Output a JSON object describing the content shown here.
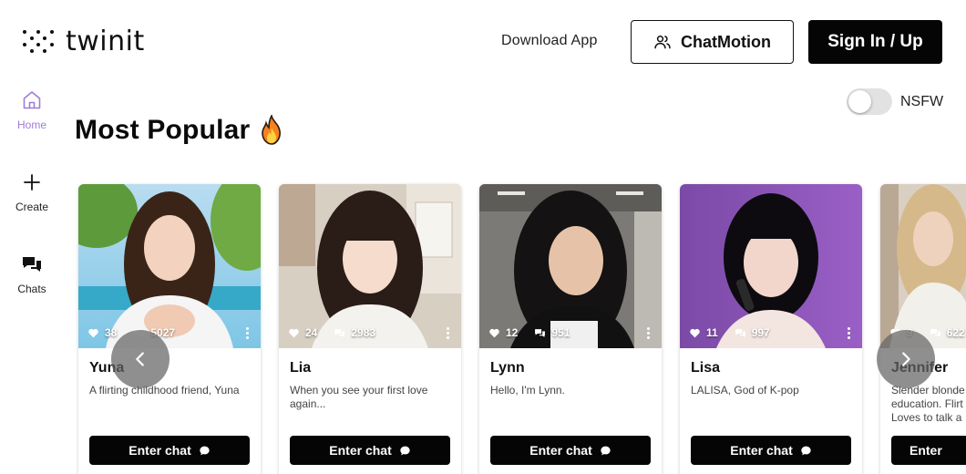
{
  "header": {
    "logo_text": "twinit",
    "download_label": "Download App",
    "chatmotion_label": "ChatMotion",
    "signin_label": "Sign In / Up"
  },
  "sidebar": {
    "items": [
      {
        "label": "Home",
        "icon": "home-icon",
        "active": true
      },
      {
        "label": "Create",
        "icon": "plus-icon",
        "active": false
      },
      {
        "label": "Chats",
        "icon": "chat-bubbles-icon",
        "active": false
      }
    ]
  },
  "nsfw": {
    "label": "NSFW",
    "enabled": false
  },
  "section": {
    "title": "Most Popular",
    "emoji": "fire-icon"
  },
  "cards": [
    {
      "name": "Yuna",
      "likes": "38",
      "chats": "5027",
      "desc": "A flirting childhood friend, Yuna",
      "button": "Enter chat"
    },
    {
      "name": "Lia",
      "likes": "24",
      "chats": "2983",
      "desc": "When you see your first love again...",
      "button": "Enter chat"
    },
    {
      "name": "Lynn",
      "likes": "12",
      "chats": "951",
      "desc": "Hello, I'm Lynn.",
      "button": "Enter chat"
    },
    {
      "name": "Lisa",
      "likes": "11",
      "chats": "997",
      "desc": "LALISA, God of K-pop",
      "button": "Enter chat"
    },
    {
      "name": "Jennifer",
      "likes": "9",
      "chats": "622",
      "desc": "Slender blonde education. Flirt Loves to talk a",
      "button": "Enter"
    }
  ],
  "colors": {
    "accent_active": "#a07cd8",
    "button_dark": "#050505",
    "fire_orange": "#f5821f"
  }
}
